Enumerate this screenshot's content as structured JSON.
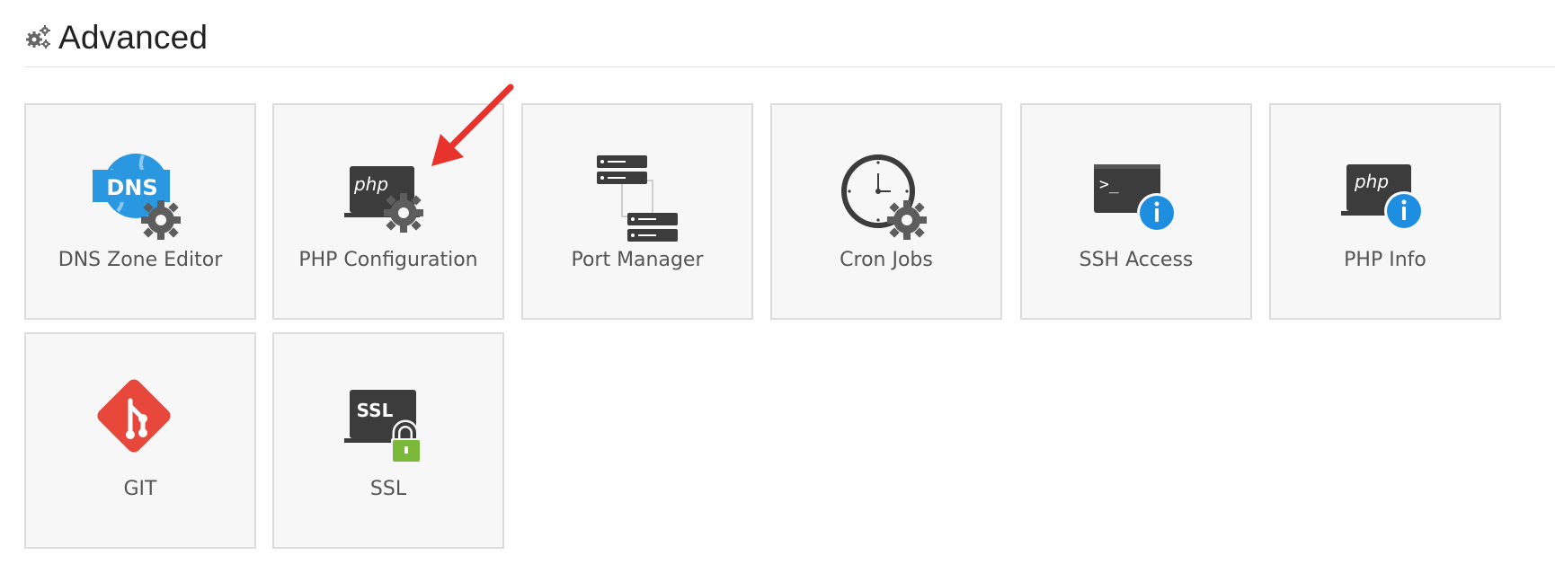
{
  "section": {
    "title": "Advanced",
    "icon": "gears-icon"
  },
  "tiles": [
    {
      "label": "DNS Zone Editor",
      "icon": "dns-gear-icon",
      "icon_text": "DNS"
    },
    {
      "label": "PHP Configuration",
      "icon": "php-gear-icon",
      "icon_text": "php"
    },
    {
      "label": "Port Manager",
      "icon": "servers-icon"
    },
    {
      "label": "Cron Jobs",
      "icon": "clock-gear-icon"
    },
    {
      "label": "SSH Access",
      "icon": "terminal-info-icon",
      "icon_text": ">_"
    },
    {
      "label": "PHP Info",
      "icon": "php-info-icon",
      "icon_text": "php"
    },
    {
      "label": "GIT",
      "icon": "git-icon"
    },
    {
      "label": "SSL",
      "icon": "ssl-lock-icon",
      "icon_text": "SSL"
    }
  ],
  "annotation": {
    "icon": "red-arrow-annotation",
    "color": "#e8322c"
  },
  "colors": {
    "dns_blue": "#2a98e0",
    "gear_gray": "#5d5d5d",
    "dark_screen": "#3c3c3c",
    "info_blue": "#1e8fe0",
    "git_red": "#e8473b",
    "lock_green": "#7bb93a",
    "tile_bg": "#f7f7f7",
    "tile_border": "#dcdcdc"
  }
}
